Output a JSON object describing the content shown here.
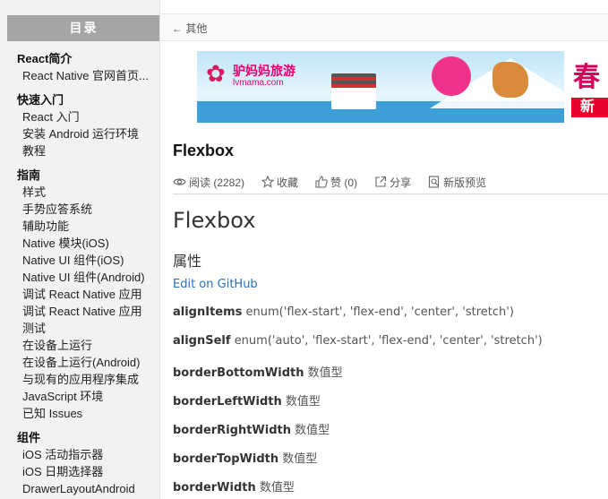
{
  "sidebar": {
    "header": "目录",
    "sections": [
      {
        "title": "React简介",
        "items": [
          "React Native 官网首页..."
        ]
      },
      {
        "title": "快速入门",
        "items": [
          "React 入门",
          "安装 Android 运行环境",
          "教程"
        ]
      },
      {
        "title": "指南",
        "items": [
          "样式",
          "手势应答系统",
          "辅助功能",
          "Native 模块(iOS)",
          "Native UI 组件(iOS)",
          "Native UI 组件(Android)",
          "调试 React Native 应用",
          "调试 React Native 应用",
          "测试",
          "在设备上运行",
          "在设备上运行(Android)",
          "与现有的应用程序集成",
          "JavaScript 环境",
          "已知 Issues"
        ]
      },
      {
        "title": "组件",
        "items": [
          "iOS 活动指示器",
          "iOS 日期选择器",
          "DrawerLayoutAndroid"
        ]
      }
    ]
  },
  "topbar": {
    "back_label": "← 其他"
  },
  "banner": {
    "brand": "驴妈妈旅游",
    "brand_url": "lvmama.com",
    "char_top": "春",
    "char_bottom": "新"
  },
  "article": {
    "title": "Flexbox",
    "meta": {
      "read_label": "阅读 (2282)",
      "fav_label": "收藏",
      "like_label": "赞 (0)",
      "share_label": "分享",
      "preview_label": "新版预览"
    },
    "heading": "Flexbox",
    "subheading": "属性",
    "edit_link": "Edit on GitHub",
    "props": [
      {
        "name": "alignItems",
        "type": "enum('flex-start', 'flex-end', 'center', 'stretch')"
      },
      {
        "name": "alignSelf",
        "type": "enum('auto', 'flex-start', 'flex-end', 'center', 'stretch')"
      },
      {
        "name": "borderBottomWidth",
        "type": "数值型"
      },
      {
        "name": "borderLeftWidth",
        "type": "数值型"
      },
      {
        "name": "borderRightWidth",
        "type": "数值型"
      },
      {
        "name": "borderTopWidth",
        "type": "数值型"
      },
      {
        "name": "borderWidth",
        "type": "数值型"
      }
    ]
  },
  "colors": {
    "link": "#2a6eb8",
    "sidebar_header": "#a5a5a5",
    "brand": "#e3006e"
  }
}
